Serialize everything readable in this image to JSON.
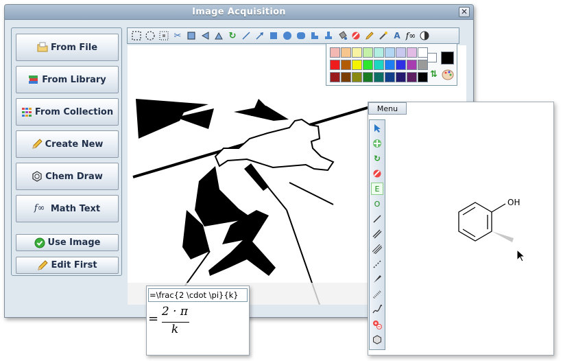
{
  "window": {
    "title": "Image Acquisition",
    "close_icon": "close-icon"
  },
  "left_panel": {
    "buttons": [
      {
        "label": "From File",
        "icon": "folder-icon"
      },
      {
        "label": "From Library",
        "icon": "books-icon"
      },
      {
        "label": "From Collection",
        "icon": "grid-icon"
      },
      {
        "label": "Create New",
        "icon": "pencil-icon"
      },
      {
        "label": "Chem Draw",
        "icon": "benzene-icon"
      },
      {
        "label": "Math Text",
        "icon": "fx-icon",
        "icon_text": "f∞"
      },
      {
        "label": "Use Image",
        "icon": "check-circle-icon"
      },
      {
        "label": "Edit First",
        "icon": "pencil-icon"
      }
    ]
  },
  "toolbar": {
    "tools": [
      "rect-select",
      "ellipse-select",
      "lasso-select",
      "scissors",
      "crop",
      "flip-horizontal",
      "flip-vertical",
      "rotate",
      "line",
      "arrow",
      "rectangle",
      "ellipse",
      "rounded-rect",
      "polygon",
      "stamp",
      "fill-bucket",
      "eraser",
      "pencil",
      "magic-wand",
      "text",
      "math-text",
      "contrast"
    ],
    "math_text_label": "f∞"
  },
  "palette": {
    "colors": [
      [
        "#f4b8b2",
        "#f6c68e",
        "#f7f3a3",
        "#c4f0a8",
        "#b2efe2",
        "#b3d7f2",
        "#c9c8ef",
        "#e2bce5",
        "#ffffff"
      ],
      [
        "#ee1c1c",
        "#b35b00",
        "#f5f200",
        "#2ee62e",
        "#1dd6c2",
        "#1c7ef2",
        "#2f2fe6",
        "#a63cb0",
        "#9a9a9a"
      ],
      [
        "#991b1b",
        "#7a3f00",
        "#8a8a10",
        "#1b7b25",
        "#0c6e65",
        "#123f8a",
        "#251b6e",
        "#5d1f62",
        "#000000"
      ]
    ],
    "primary": "#ffffff",
    "secondary": "#000000",
    "swap_icon": "swap-icon",
    "palette_icon": "palette-icon"
  },
  "chem": {
    "menu_label": "Menu",
    "tools": [
      "pointer",
      "move",
      "rotate",
      "eraser",
      "element-e",
      "element-o",
      "single-bond",
      "double-bond",
      "triple-bond",
      "dashed-bond",
      "wedge-bond",
      "hash-bond",
      "wavy-bond",
      "charge",
      "ring"
    ],
    "element_e": "E",
    "element_o": "O",
    "atom_label": "OH"
  },
  "formula": {
    "input_value": "=\\frac{2 \\cdot \\pi}{k}",
    "eq": "=",
    "numerator": "2 · π",
    "denominator": "k"
  }
}
